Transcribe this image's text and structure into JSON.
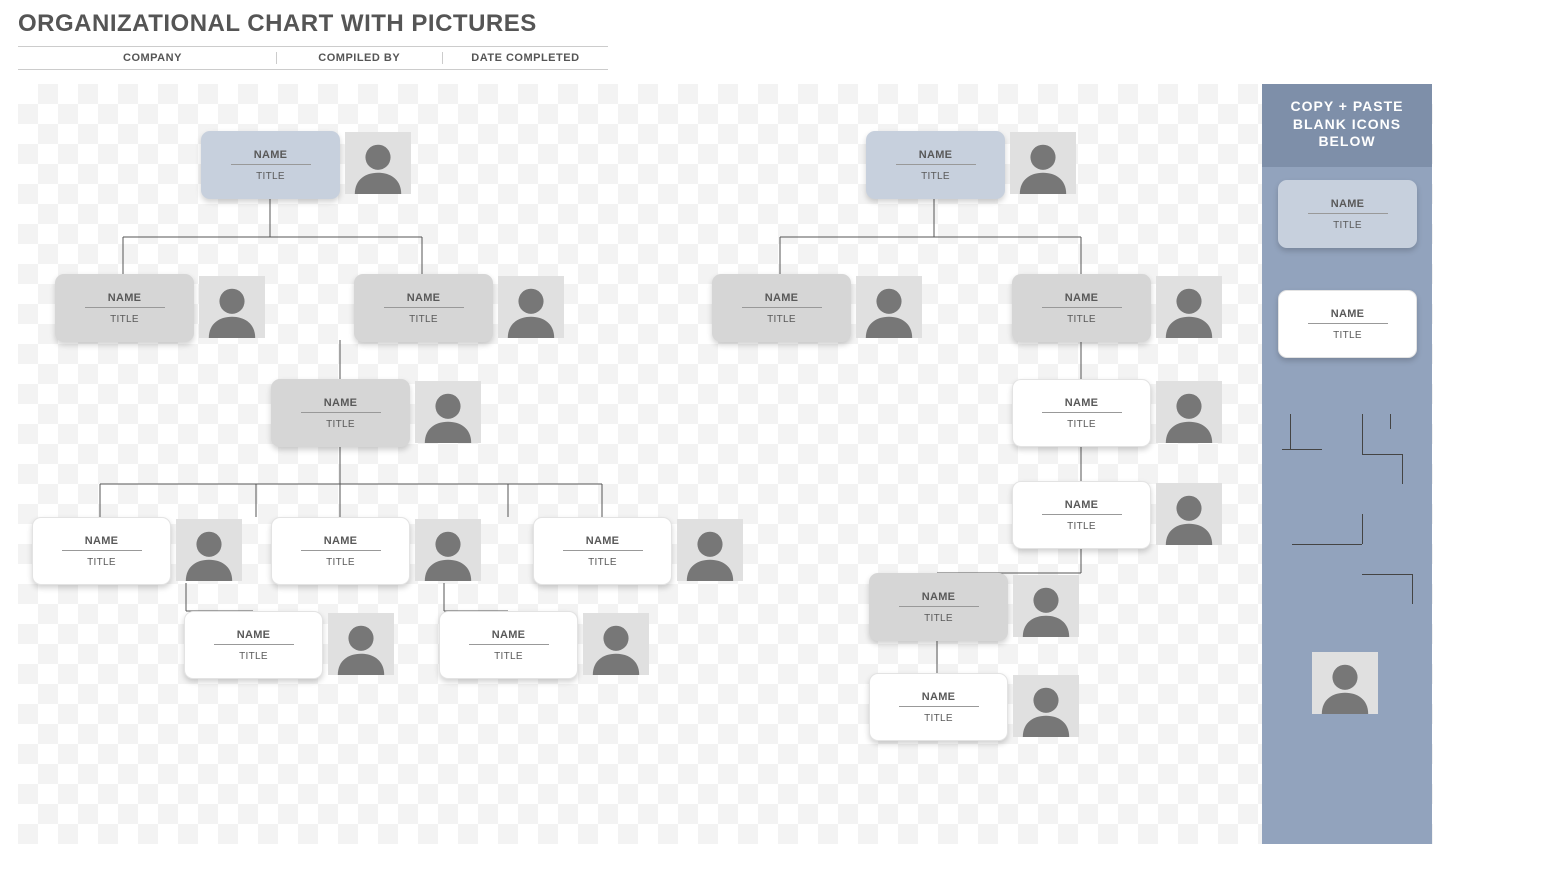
{
  "page_title": "ORGANIZATIONAL CHART WITH PICTURES",
  "meta": {
    "company_label": "COMPANY",
    "compiled_label": "COMPILED BY",
    "date_label": "DATE COMPLETED"
  },
  "sidebar": {
    "head_line1": "COPY + PASTE",
    "head_line2": "BLANK ICONS",
    "head_line3": "BELOW",
    "sample_blue": {
      "name": "NAME",
      "title": "TITLE"
    },
    "sample_white": {
      "name": "NAME",
      "title": "TITLE"
    }
  },
  "nodes": {
    "l0a": {
      "name": "NAME",
      "title": "TITLE"
    },
    "r0": {
      "name": "NAME",
      "title": "TITLE"
    },
    "l1a": {
      "name": "NAME",
      "title": "TITLE"
    },
    "l1b": {
      "name": "NAME",
      "title": "TITLE"
    },
    "r1a": {
      "name": "NAME",
      "title": "TITLE"
    },
    "r1b": {
      "name": "NAME",
      "title": "TITLE"
    },
    "l2": {
      "name": "NAME",
      "title": "TITLE"
    },
    "r2": {
      "name": "NAME",
      "title": "TITLE"
    },
    "r3": {
      "name": "NAME",
      "title": "TITLE"
    },
    "l3a": {
      "name": "NAME",
      "title": "TITLE"
    },
    "l3b": {
      "name": "NAME",
      "title": "TITLE"
    },
    "l3c": {
      "name": "NAME",
      "title": "TITLE"
    },
    "l4a": {
      "name": "NAME",
      "title": "TITLE"
    },
    "l4b": {
      "name": "NAME",
      "title": "TITLE"
    },
    "r4": {
      "name": "NAME",
      "title": "TITLE"
    },
    "r5": {
      "name": "NAME",
      "title": "TITLE"
    }
  },
  "chart_data": {
    "type": "org-chart",
    "trees": [
      {
        "id": "l0a",
        "level": 0,
        "style": "blue",
        "name": "NAME",
        "title": "TITLE",
        "children": [
          {
            "id": "l1a",
            "level": 1,
            "style": "grey",
            "name": "NAME",
            "title": "TITLE"
          },
          {
            "id": "l1b",
            "level": 1,
            "style": "grey",
            "name": "NAME",
            "title": "TITLE",
            "children": [
              {
                "id": "l2",
                "level": 2,
                "style": "grey",
                "name": "NAME",
                "title": "TITLE",
                "children": [
                  {
                    "id": "l3a",
                    "level": 3,
                    "style": "white",
                    "name": "NAME",
                    "title": "TITLE",
                    "children": [
                      {
                        "id": "l4a",
                        "level": 4,
                        "style": "white",
                        "name": "NAME",
                        "title": "TITLE"
                      }
                    ]
                  },
                  {
                    "id": "l3b",
                    "level": 3,
                    "style": "white",
                    "name": "NAME",
                    "title": "TITLE",
                    "children": [
                      {
                        "id": "l4b",
                        "level": 4,
                        "style": "white",
                        "name": "NAME",
                        "title": "TITLE"
                      }
                    ]
                  },
                  {
                    "id": "l3c",
                    "level": 3,
                    "style": "white",
                    "name": "NAME",
                    "title": "TITLE"
                  }
                ]
              }
            ]
          }
        ]
      },
      {
        "id": "r0",
        "level": 0,
        "style": "blue",
        "name": "NAME",
        "title": "TITLE",
        "children": [
          {
            "id": "r1a",
            "level": 1,
            "style": "grey",
            "name": "NAME",
            "title": "TITLE"
          },
          {
            "id": "r1b",
            "level": 1,
            "style": "grey",
            "name": "NAME",
            "title": "TITLE",
            "children": [
              {
                "id": "r2",
                "level": 2,
                "style": "white",
                "name": "NAME",
                "title": "TITLE",
                "children": [
                  {
                    "id": "r3",
                    "level": 3,
                    "style": "white",
                    "name": "NAME",
                    "title": "TITLE",
                    "children": [
                      {
                        "id": "r4",
                        "level": 4,
                        "style": "grey",
                        "name": "NAME",
                        "title": "TITLE",
                        "children": [
                          {
                            "id": "r5",
                            "level": 5,
                            "style": "white",
                            "name": "NAME",
                            "title": "TITLE"
                          }
                        ]
                      }
                    ]
                  }
                ]
              }
            ]
          }
        ]
      }
    ]
  }
}
